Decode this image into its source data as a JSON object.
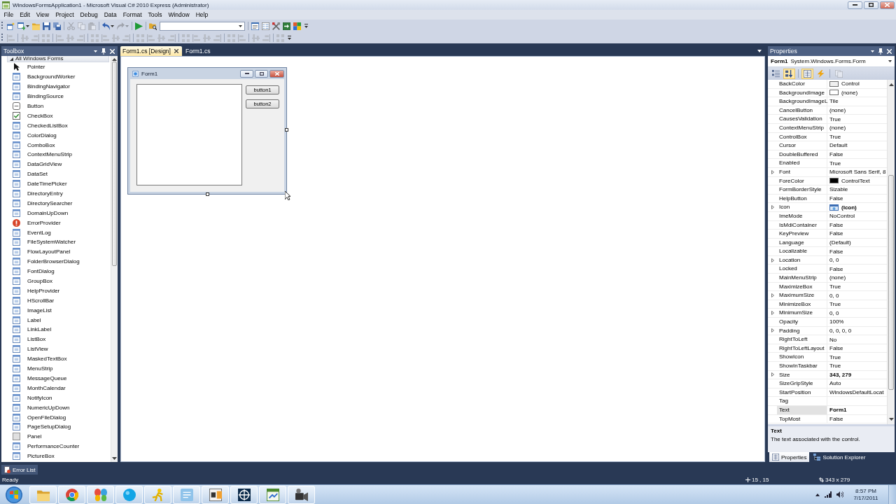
{
  "window": {
    "title": "WindowsFormsApplication1 - Microsoft Visual C# 2010 Express (Administrator)"
  },
  "menu": [
    "File",
    "Edit",
    "View",
    "Project",
    "Debug",
    "Data",
    "Format",
    "Tools",
    "Window",
    "Help"
  ],
  "toolbars": [
    {
      "groups": [
        [
          {
            "kind": "button",
            "disabled": false,
            "dropdown": false
          },
          {
            "kind": "button",
            "disabled": false,
            "dropdown": true
          },
          {
            "kind": "button",
            "disabled": false,
            "dropdown": false
          },
          {
            "kind": "button",
            "disabled": false,
            "dropdown": false
          },
          {
            "kind": "button",
            "disabled": false,
            "dropdown": false
          }
        ],
        [
          {
            "kind": "button",
            "disabled": true,
            "dropdown": false
          },
          {
            "kind": "button",
            "disabled": true,
            "dropdown": false
          },
          {
            "kind": "button",
            "disabled": true,
            "dropdown": false
          }
        ],
        [
          {
            "kind": "button",
            "disabled": false,
            "dropdown": true
          },
          {
            "kind": "button",
            "disabled": true,
            "dropdown": true
          }
        ],
        [
          {
            "kind": "button",
            "disabled": false,
            "dropdown": false
          }
        ],
        [
          {
            "kind": "button",
            "disabled": false,
            "dropdown": false
          },
          {
            "kind": "combo",
            "disabled": false,
            "dropdown": true
          }
        ],
        [
          {
            "kind": "button",
            "disabled": false,
            "dropdown": false
          },
          {
            "kind": "button",
            "disabled": false,
            "dropdown": false
          },
          {
            "kind": "button",
            "disabled": false,
            "dropdown": false
          },
          {
            "kind": "button",
            "disabled": false,
            "dropdown": false
          },
          {
            "kind": "button",
            "disabled": false,
            "dropdown": false
          }
        ]
      ]
    },
    {
      "groups": [
        [
          {
            "kind": "button",
            "disabled": true,
            "dropdown": false
          }
        ],
        [
          {
            "kind": "button",
            "disabled": true,
            "dropdown": false
          },
          {
            "kind": "button",
            "disabled": true,
            "dropdown": false
          },
          {
            "kind": "button",
            "disabled": true,
            "dropdown": false
          }
        ],
        [
          {
            "kind": "button",
            "disabled": true,
            "dropdown": false
          },
          {
            "kind": "button",
            "disabled": true,
            "dropdown": false
          },
          {
            "kind": "button",
            "disabled": true,
            "dropdown": false
          }
        ],
        [
          {
            "kind": "button",
            "disabled": true,
            "dropdown": false
          },
          {
            "kind": "button",
            "disabled": true,
            "dropdown": false
          },
          {
            "kind": "button",
            "disabled": true,
            "dropdown": false
          },
          {
            "kind": "button",
            "disabled": true,
            "dropdown": false
          }
        ],
        [
          {
            "kind": "button",
            "disabled": true,
            "dropdown": false
          },
          {
            "kind": "button",
            "disabled": true,
            "dropdown": false
          },
          {
            "kind": "button",
            "disabled": true,
            "dropdown": false
          },
          {
            "kind": "button",
            "disabled": true,
            "dropdown": false
          }
        ],
        [
          {
            "kind": "button",
            "disabled": true,
            "dropdown": false
          },
          {
            "kind": "button",
            "disabled": true,
            "dropdown": false
          },
          {
            "kind": "button",
            "disabled": true,
            "dropdown": false
          },
          {
            "kind": "button",
            "disabled": true,
            "dropdown": false
          }
        ],
        [
          {
            "kind": "button",
            "disabled": true,
            "dropdown": false
          },
          {
            "kind": "button",
            "disabled": true,
            "dropdown": false
          }
        ],
        [
          {
            "kind": "button",
            "disabled": true,
            "dropdown": false
          },
          {
            "kind": "button",
            "disabled": true,
            "dropdown": false
          }
        ],
        [
          {
            "kind": "button",
            "disabled": true,
            "dropdown": false
          }
        ]
      ]
    }
  ],
  "toolbox": {
    "title": "Toolbox",
    "group": {
      "label": "All Windows Forms",
      "expanded": true,
      "items": [
        {
          "label": "Pointer",
          "selected": false
        },
        {
          "label": "BackgroundWorker",
          "selected": false
        },
        {
          "label": "BindingNavigator",
          "selected": false
        },
        {
          "label": "BindingSource",
          "selected": false
        },
        {
          "label": "Button",
          "selected": false
        },
        {
          "label": "CheckBox",
          "selected": false
        },
        {
          "label": "CheckedListBox",
          "selected": false
        },
        {
          "label": "ColorDialog",
          "selected": false
        },
        {
          "label": "ComboBox",
          "selected": false
        },
        {
          "label": "ContextMenuStrip",
          "selected": false
        },
        {
          "label": "DataGridView",
          "selected": false
        },
        {
          "label": "DataSet",
          "selected": false
        },
        {
          "label": "DateTimePicker",
          "selected": false
        },
        {
          "label": "DirectoryEntry",
          "selected": false
        },
        {
          "label": "DirectorySearcher",
          "selected": false
        },
        {
          "label": "DomainUpDown",
          "selected": false
        },
        {
          "label": "ErrorProvider",
          "selected": false
        },
        {
          "label": "EventLog",
          "selected": false
        },
        {
          "label": "FileSystemWatcher",
          "selected": false
        },
        {
          "label": "FlowLayoutPanel",
          "selected": false
        },
        {
          "label": "FolderBrowserDialog",
          "selected": false
        },
        {
          "label": "FontDialog",
          "selected": false
        },
        {
          "label": "GroupBox",
          "selected": false
        },
        {
          "label": "HelpProvider",
          "selected": false
        },
        {
          "label": "HScrollBar",
          "selected": false
        },
        {
          "label": "ImageList",
          "selected": false
        },
        {
          "label": "Label",
          "selected": false
        },
        {
          "label": "LinkLabel",
          "selected": false
        },
        {
          "label": "ListBox",
          "selected": false
        },
        {
          "label": "ListView",
          "selected": false
        },
        {
          "label": "MaskedTextBox",
          "selected": false
        },
        {
          "label": "MenuStrip",
          "selected": false
        },
        {
          "label": "MessageQueue",
          "selected": false
        },
        {
          "label": "MonthCalendar",
          "selected": false
        },
        {
          "label": "NotifyIcon",
          "selected": false
        },
        {
          "label": "NumericUpDown",
          "selected": false
        },
        {
          "label": "OpenFileDialog",
          "selected": false
        },
        {
          "label": "PageSetupDialog",
          "selected": false
        },
        {
          "label": "Panel",
          "selected": false
        },
        {
          "label": "PerformanceCounter",
          "selected": false
        },
        {
          "label": "PictureBox",
          "selected": false
        }
      ]
    }
  },
  "document_tabs": [
    {
      "label": "Form1.cs [Design]",
      "selected": true
    },
    {
      "label": "Form1.cs",
      "selected": false
    }
  ],
  "designer": {
    "form": {
      "title": "Form1",
      "buttons": [
        "button1",
        "button2"
      ]
    }
  },
  "properties": {
    "title": "Properties",
    "object_name": "Form1",
    "object_type": "System.Windows.Forms.Form",
    "toolbar": [
      [
        {
          "selected": false,
          "disabled": false
        },
        {
          "selected": true,
          "disabled": false
        }
      ],
      [
        {
          "selected": true,
          "disabled": false
        },
        {
          "selected": false,
          "disabled": false
        }
      ],
      [
        {
          "selected": false,
          "disabled": true
        }
      ]
    ],
    "rows": [
      {
        "name": "BackColor",
        "value": "Control",
        "kind": "color",
        "color": "#f0f0f0",
        "expandable": false,
        "modified": false,
        "selected": false
      },
      {
        "name": "BackgroundImage",
        "value": "(none)",
        "kind": "image",
        "expandable": false,
        "modified": false,
        "selected": false
      },
      {
        "name": "BackgroundImageL",
        "value": "Tile",
        "kind": "text",
        "expandable": false,
        "modified": false,
        "selected": false
      },
      {
        "name": "CancelButton",
        "value": "(none)",
        "kind": "text",
        "expandable": false,
        "modified": false,
        "selected": false
      },
      {
        "name": "CausesValidation",
        "value": "True",
        "kind": "text",
        "expandable": false,
        "modified": false,
        "selected": false
      },
      {
        "name": "ContextMenuStrip",
        "value": "(none)",
        "kind": "text",
        "expandable": false,
        "modified": false,
        "selected": false
      },
      {
        "name": "ControlBox",
        "value": "True",
        "kind": "text",
        "expandable": false,
        "modified": false,
        "selected": false
      },
      {
        "name": "Cursor",
        "value": "Default",
        "kind": "text",
        "expandable": false,
        "modified": false,
        "selected": false
      },
      {
        "name": "DoubleBuffered",
        "value": "False",
        "kind": "text",
        "expandable": false,
        "modified": false,
        "selected": false
      },
      {
        "name": "Enabled",
        "value": "True",
        "kind": "text",
        "expandable": false,
        "modified": false,
        "selected": false
      },
      {
        "name": "Font",
        "value": "Microsoft Sans Serif, 8",
        "kind": "text",
        "expandable": true,
        "modified": false,
        "selected": false
      },
      {
        "name": "ForeColor",
        "value": "ControlText",
        "kind": "color",
        "color": "#000000",
        "expandable": false,
        "modified": false,
        "selected": false
      },
      {
        "name": "FormBorderStyle",
        "value": "Sizable",
        "kind": "text",
        "expandable": false,
        "modified": false,
        "selected": false
      },
      {
        "name": "HelpButton",
        "value": "False",
        "kind": "text",
        "expandable": false,
        "modified": false,
        "selected": false
      },
      {
        "name": "Icon",
        "value": "(Icon)",
        "kind": "icon",
        "expandable": true,
        "modified": true,
        "selected": false
      },
      {
        "name": "ImeMode",
        "value": "NoControl",
        "kind": "text",
        "expandable": false,
        "modified": false,
        "selected": false
      },
      {
        "name": "IsMdiContainer",
        "value": "False",
        "kind": "text",
        "expandable": false,
        "modified": false,
        "selected": false
      },
      {
        "name": "KeyPreview",
        "value": "False",
        "kind": "text",
        "expandable": false,
        "modified": false,
        "selected": false
      },
      {
        "name": "Language",
        "value": "(Default)",
        "kind": "text",
        "expandable": false,
        "modified": false,
        "selected": false
      },
      {
        "name": "Localizable",
        "value": "False",
        "kind": "text",
        "expandable": false,
        "modified": false,
        "selected": false
      },
      {
        "name": "Location",
        "value": "0, 0",
        "kind": "text",
        "expandable": true,
        "modified": false,
        "selected": false
      },
      {
        "name": "Locked",
        "value": "False",
        "kind": "text",
        "expandable": false,
        "modified": false,
        "selected": false
      },
      {
        "name": "MainMenuStrip",
        "value": "(none)",
        "kind": "text",
        "expandable": false,
        "modified": false,
        "selected": false
      },
      {
        "name": "MaximizeBox",
        "value": "True",
        "kind": "text",
        "expandable": false,
        "modified": false,
        "selected": false
      },
      {
        "name": "MaximumSize",
        "value": "0, 0",
        "kind": "text",
        "expandable": true,
        "modified": false,
        "selected": false
      },
      {
        "name": "MinimizeBox",
        "value": "True",
        "kind": "text",
        "expandable": false,
        "modified": false,
        "selected": false
      },
      {
        "name": "MinimumSize",
        "value": "0, 0",
        "kind": "text",
        "expandable": true,
        "modified": false,
        "selected": false
      },
      {
        "name": "Opacity",
        "value": "100%",
        "kind": "text",
        "expandable": false,
        "modified": false,
        "selected": false
      },
      {
        "name": "Padding",
        "value": "0, 0, 0, 0",
        "kind": "text",
        "expandable": true,
        "modified": false,
        "selected": false
      },
      {
        "name": "RightToLeft",
        "value": "No",
        "kind": "text",
        "expandable": false,
        "modified": false,
        "selected": false
      },
      {
        "name": "RightToLeftLayout",
        "value": "False",
        "kind": "text",
        "expandable": false,
        "modified": false,
        "selected": false
      },
      {
        "name": "ShowIcon",
        "value": "True",
        "kind": "text",
        "expandable": false,
        "modified": false,
        "selected": false
      },
      {
        "name": "ShowInTaskbar",
        "value": "True",
        "kind": "text",
        "expandable": false,
        "modified": false,
        "selected": false
      },
      {
        "name": "Size",
        "value": "343, 279",
        "kind": "text",
        "expandable": true,
        "modified": true,
        "selected": false
      },
      {
        "name": "SizeGripStyle",
        "value": "Auto",
        "kind": "text",
        "expandable": false,
        "modified": false,
        "selected": false
      },
      {
        "name": "StartPosition",
        "value": "WindowsDefaultLocat",
        "kind": "text",
        "expandable": false,
        "modified": false,
        "selected": false
      },
      {
        "name": "Tag",
        "kind": "text",
        "expandable": false,
        "selected": false
      },
      {
        "name": "Text",
        "value": "Form1",
        "kind": "text",
        "expandable": false,
        "modified": true,
        "selected": true
      },
      {
        "name": "TopMost",
        "value": "False",
        "kind": "text",
        "expandable": false,
        "modified": false,
        "selected": false
      }
    ],
    "description": {
      "title": "Text",
      "text": "The text associated with the control."
    }
  },
  "panel_tabs": [
    {
      "label": "Properties",
      "selected": true
    },
    {
      "label": "Solution Explorer",
      "selected": false
    }
  ],
  "bottom_tabs": [
    {
      "label": "Error List"
    }
  ],
  "status_bar": {
    "text": "Ready",
    "position": "15 , 15",
    "size": "343 x 279"
  },
  "taskbar": {
    "apps": [
      {
        "running": true
      },
      {
        "running": true
      },
      {
        "running": true
      },
      {
        "running": true
      },
      {
        "running": true
      },
      {
        "running": true
      },
      {
        "running": true
      },
      {
        "running": true
      },
      {
        "running": true
      },
      {
        "running": true
      }
    ],
    "time": "8:57 PM",
    "date": "7/17/2011"
  }
}
